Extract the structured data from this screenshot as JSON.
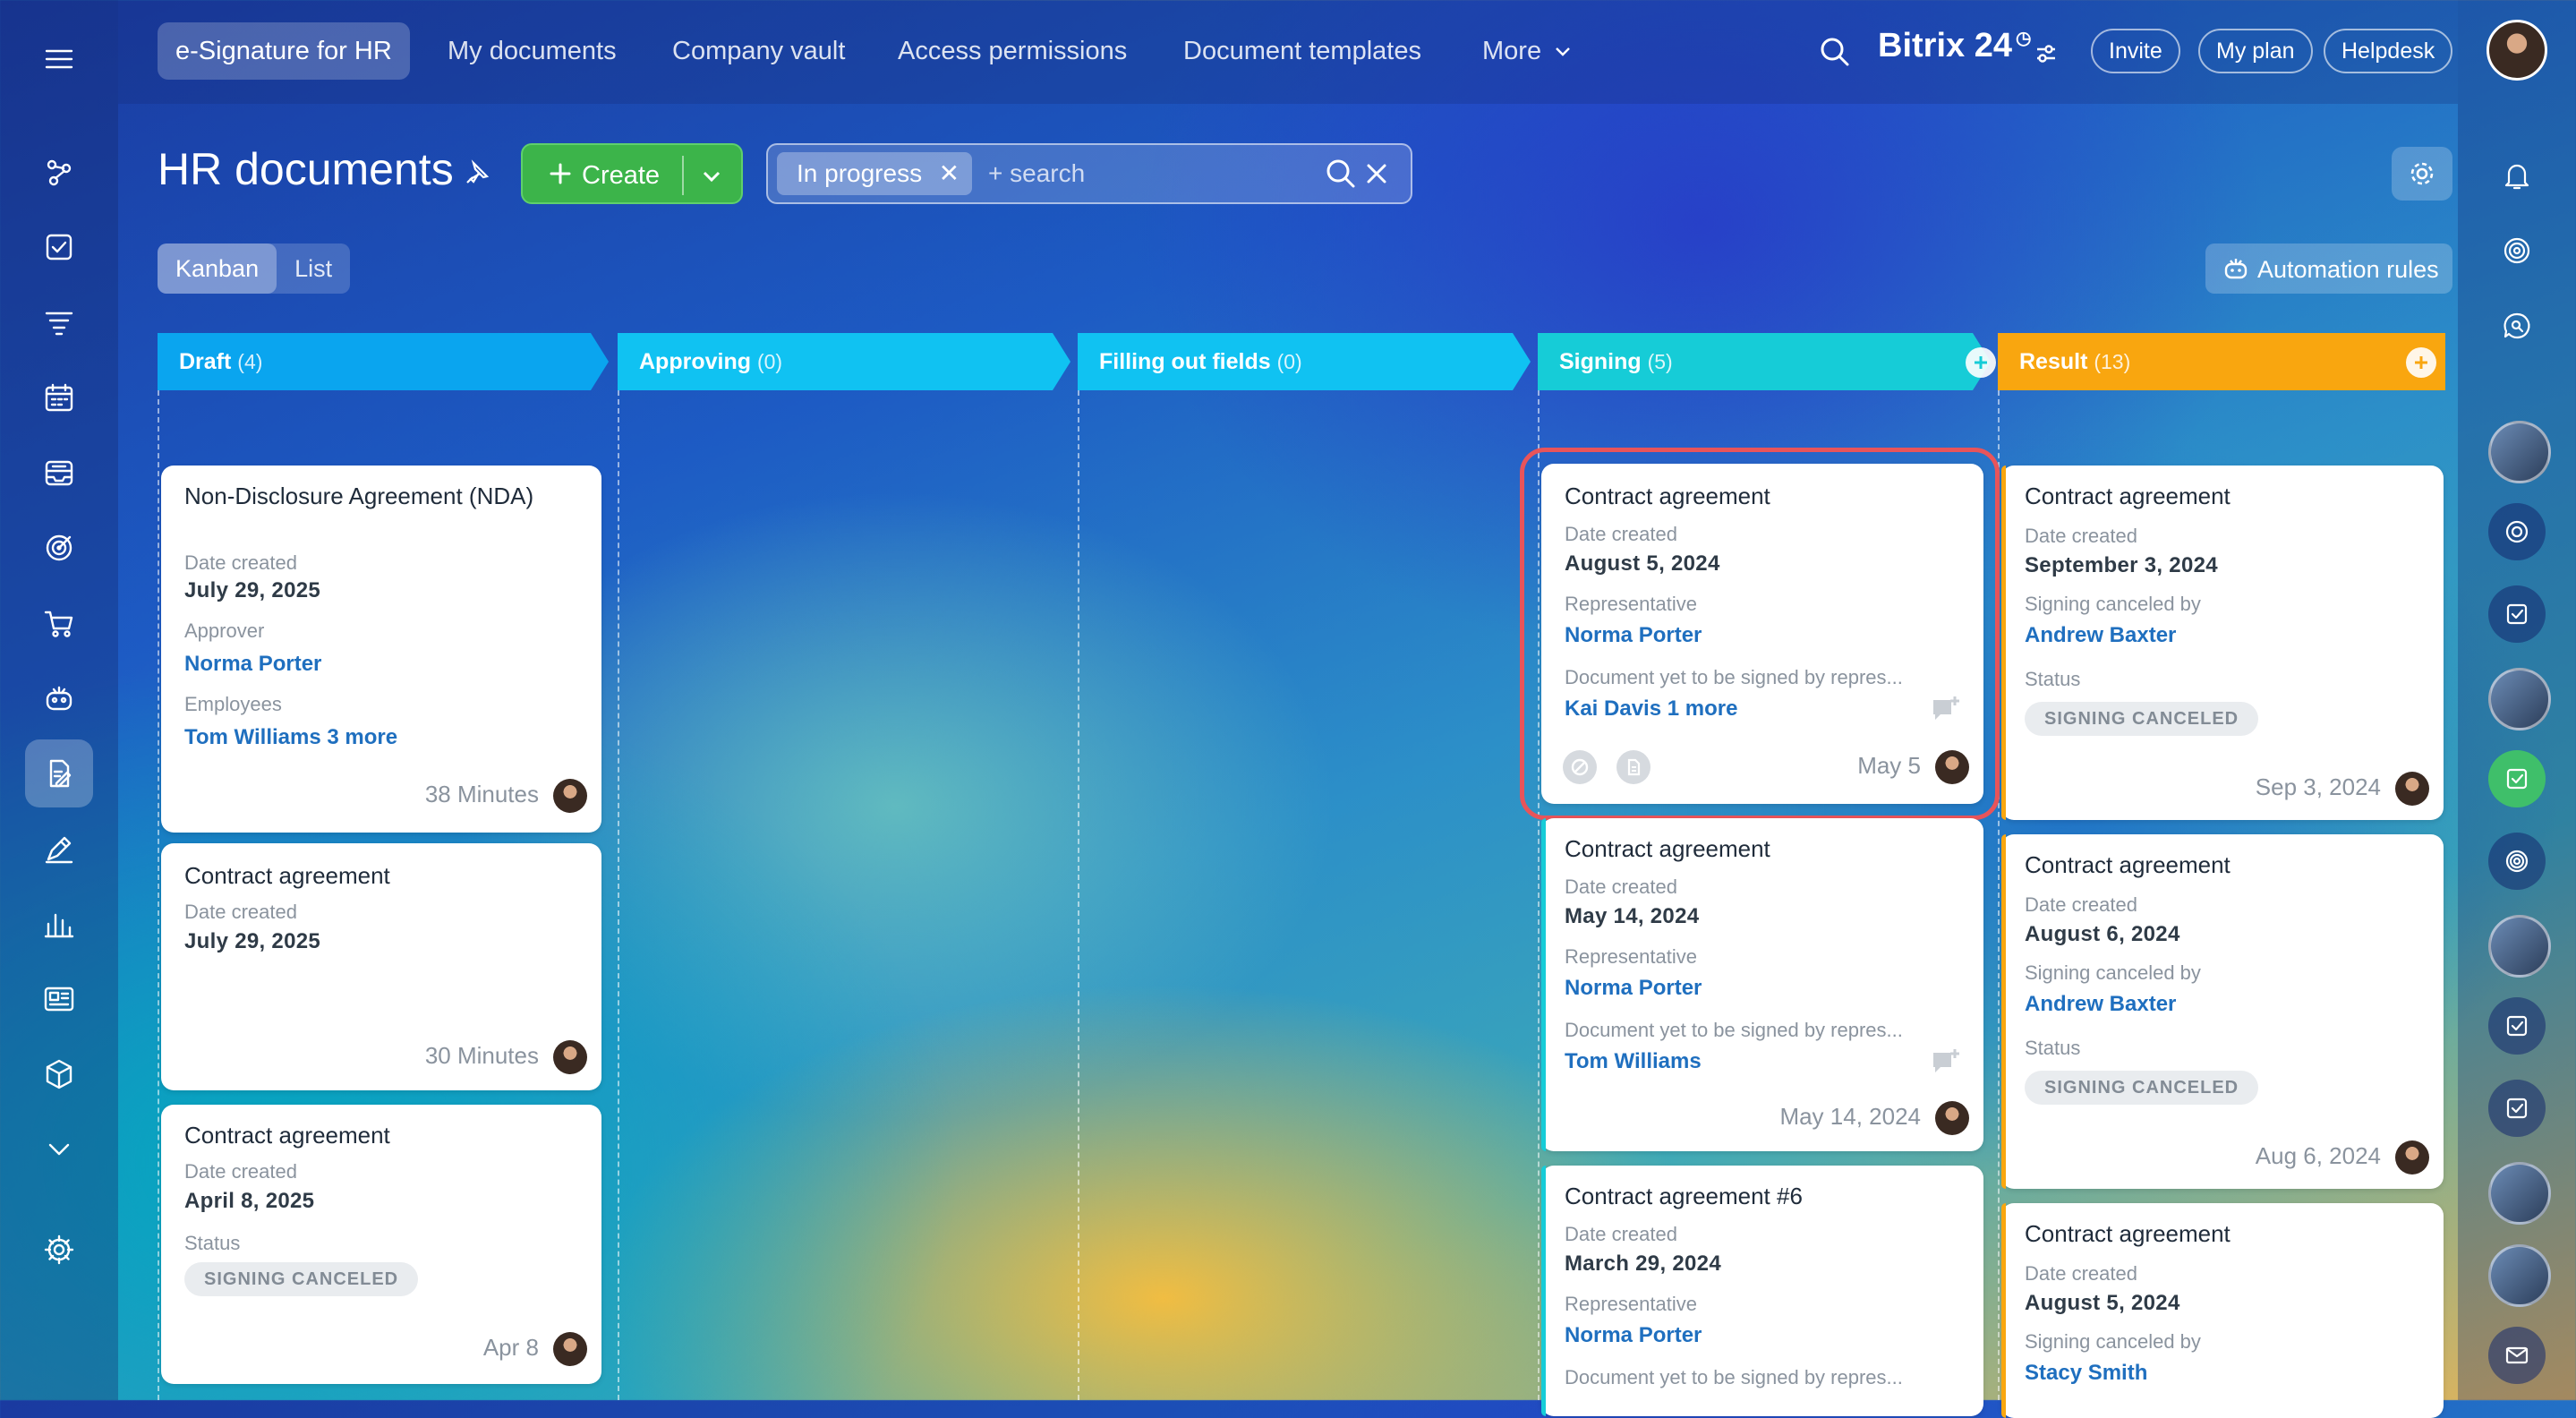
{
  "topnav": {
    "tabs": [
      "e-Signature for HR",
      "My documents",
      "Company vault",
      "Access permissions",
      "Document templates",
      "More"
    ],
    "brand": "Bitrix 24",
    "invite": "Invite",
    "my_plan": "My plan",
    "helpdesk": "Helpdesk"
  },
  "page": {
    "title": "HR documents",
    "create_label": "Create",
    "filter_tag": "In progress",
    "search_placeholder": "+ search",
    "views": [
      "Kanban",
      "List"
    ],
    "automation_rules": "Automation rules"
  },
  "columns": [
    {
      "name": "Draft",
      "count": "(4)",
      "color": "#0aa5ef"
    },
    {
      "name": "Approving",
      "count": "(0)",
      "color": "#10c2f2"
    },
    {
      "name": "Filling out fields",
      "count": "(0)",
      "color": "#10c2f2"
    },
    {
      "name": "Signing",
      "count": "(5)",
      "color": "#16ccd7"
    },
    {
      "name": "Result",
      "count": "(13)",
      "color": "#f9a60f"
    }
  ],
  "draft_cards": [
    {
      "title": "Non-Disclosure Agreement (NDA)",
      "date_label": "Date created",
      "date": "July 29, 2025",
      "approver_label": "Approver",
      "approver": "Norma Porter",
      "employees_label": "Employees",
      "employees": "Tom Williams 3 more",
      "time": "38 Minutes"
    },
    {
      "title": "Contract agreement",
      "date_label": "Date created",
      "date": "July 29, 2025",
      "time": "30 Minutes"
    },
    {
      "title": "Contract agreement",
      "date_label": "Date created",
      "date": "April 8, 2025",
      "status_label": "Status",
      "status": "SIGNING CANCELED",
      "time": "Apr 8"
    }
  ],
  "signing_cards": [
    {
      "title": "Contract agreement",
      "date_label": "Date created",
      "date": "August 5, 2024",
      "rep_label": "Representative",
      "rep": "Norma Porter",
      "pending_label": "Document yet to be signed by repres...",
      "pending": "Kai Davis 1 more",
      "time": "May 5"
    },
    {
      "title": "Contract agreement",
      "date_label": "Date created",
      "date": "May 14, 2024",
      "rep_label": "Representative",
      "rep": "Norma Porter",
      "pending_label": "Document yet to be signed by repres...",
      "pending": "Tom Williams",
      "time": "May 14, 2024"
    },
    {
      "title": "Contract agreement #6",
      "date_label": "Date created",
      "date": "March 29, 2024",
      "rep_label": "Representative",
      "rep": "Norma Porter",
      "pending_label": "Document yet to be signed by repres..."
    }
  ],
  "result_cards": [
    {
      "title": "Contract agreement",
      "date_label": "Date created",
      "date": "September 3, 2024",
      "canceled_label": "Signing canceled by",
      "canceled_by": "Andrew Baxter",
      "status_label": "Status",
      "status": "SIGNING CANCELED",
      "time": "Sep 3, 2024"
    },
    {
      "title": "Contract agreement",
      "date_label": "Date created",
      "date": "August 6, 2024",
      "canceled_label": "Signing canceled by",
      "canceled_by": "Andrew Baxter",
      "status_label": "Status",
      "status": "SIGNING CANCELED",
      "time": "Aug 6, 2024"
    },
    {
      "title": "Contract agreement",
      "date_label": "Date created",
      "date": "August 5, 2024",
      "canceled_label": "Signing canceled by",
      "canceled_by": "Stacy Smith"
    }
  ],
  "colors": {
    "accent_green": "#3cb44a",
    "link": "#1f6fbf",
    "highlight": "#e8545a"
  }
}
